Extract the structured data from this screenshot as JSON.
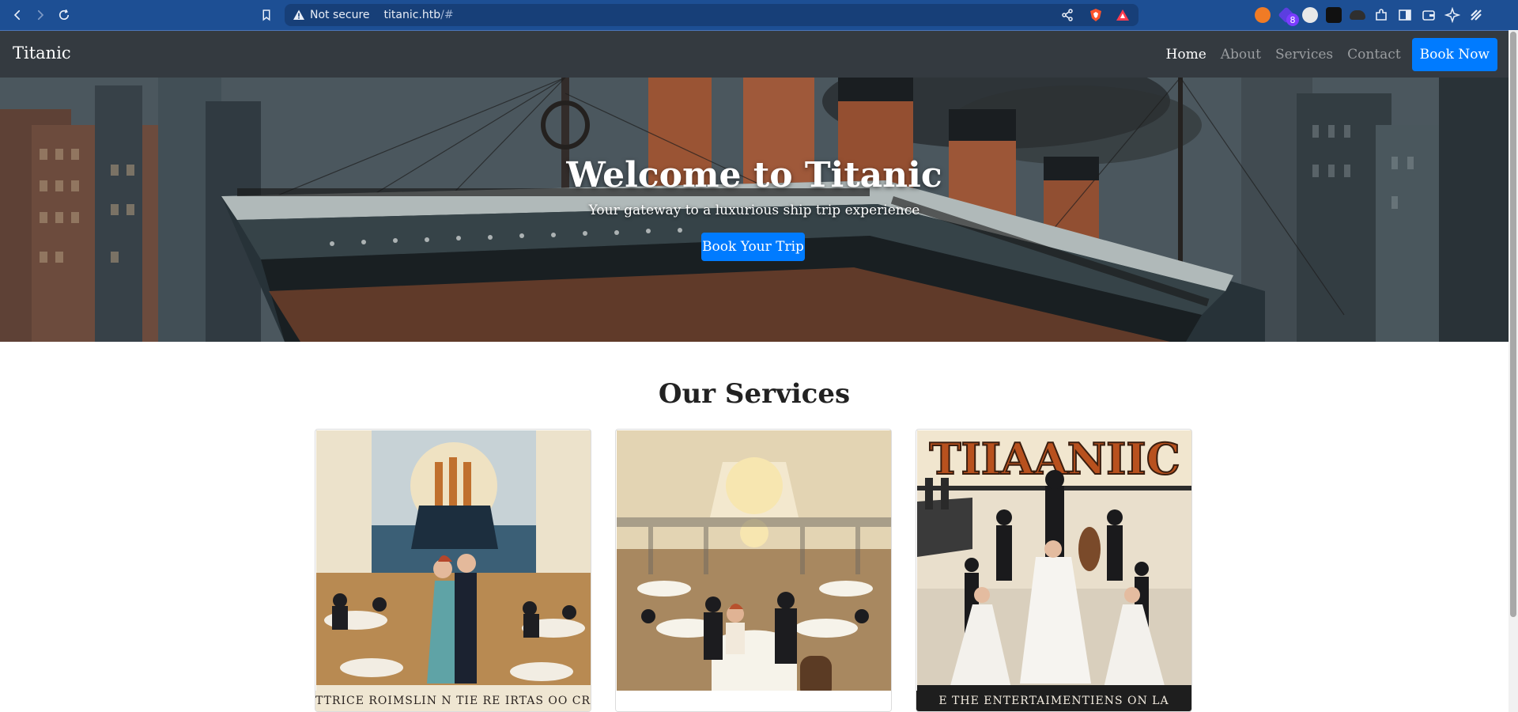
{
  "browser": {
    "security_label": "Not secure",
    "url_host": "titanic.htb",
    "url_path": "/#",
    "extension_badge": "8"
  },
  "navbar": {
    "brand": "Titanic",
    "links": [
      {
        "label": "Home",
        "active": true
      },
      {
        "label": "About",
        "active": false
      },
      {
        "label": "Services",
        "active": false
      },
      {
        "label": "Contact",
        "active": false
      }
    ],
    "cta": "Book Now"
  },
  "hero": {
    "title": "Welcome to Titanic",
    "subtitle": "Your gateway to a luxurious ship trip experience",
    "button": "Book Your Trip"
  },
  "services": {
    "title": "Our Services",
    "cards": [
      {
        "image": "ballroom-dance-poster",
        "caption": "TTRICE ROIMSLIN N TIE RE IRTAS OO CRAS I"
      },
      {
        "image": "grand-dining-hall",
        "caption": ""
      },
      {
        "image": "entertainment-poster",
        "caption": "E THE ENTERTAIMENTIENS ON LA",
        "poster_title": "TIIAANIIC"
      }
    ]
  },
  "colors": {
    "chrome": "#1d4f94",
    "navbar": "#343a40",
    "primary": "#007bff"
  }
}
